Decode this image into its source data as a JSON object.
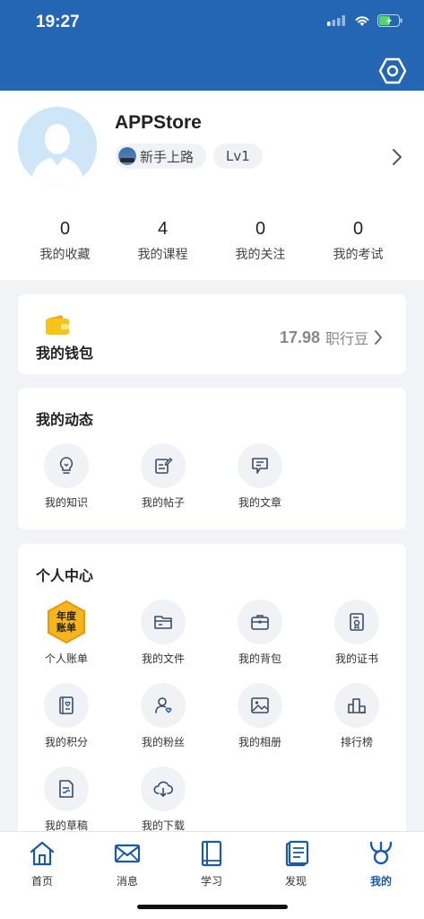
{
  "status": {
    "time": "19:27"
  },
  "profile": {
    "username": "APPStore",
    "rank_badge": "新手上路",
    "level_badge": "Lv1",
    "stats": [
      {
        "value": "0",
        "label": "我的收藏"
      },
      {
        "value": "4",
        "label": "我的课程"
      },
      {
        "value": "0",
        "label": "我的关注"
      },
      {
        "value": "0",
        "label": "我的考试"
      }
    ]
  },
  "wallet": {
    "title": "我的钱包",
    "amount": "17.98",
    "unit": "职行豆"
  },
  "dynamics": {
    "title": "我的动态",
    "items": [
      {
        "label": "我的知识",
        "icon": "lightbulb-icon"
      },
      {
        "label": "我的帖子",
        "icon": "edit-note-icon"
      },
      {
        "label": "我的文章",
        "icon": "article-icon"
      }
    ]
  },
  "personal": {
    "title": "个人中心",
    "annual_badge_text": [
      "年度",
      "账单"
    ],
    "items": [
      {
        "label": "个人账单",
        "icon": "annual-bill-icon"
      },
      {
        "label": "我的文件",
        "icon": "folder-icon"
      },
      {
        "label": "我的背包",
        "icon": "backpack-icon"
      },
      {
        "label": "我的证书",
        "icon": "certificate-icon"
      },
      {
        "label": "我的积分",
        "icon": "points-icon"
      },
      {
        "label": "我的粉丝",
        "icon": "fans-icon"
      },
      {
        "label": "我的相册",
        "icon": "album-icon"
      },
      {
        "label": "排行榜",
        "icon": "leaderboard-icon"
      },
      {
        "label": "我的草稿",
        "icon": "draft-icon"
      },
      {
        "label": "我的下载",
        "icon": "download-icon"
      }
    ]
  },
  "tabbar": {
    "active": "我的",
    "items": [
      {
        "label": "首页",
        "icon": "home-icon"
      },
      {
        "label": "消息",
        "icon": "mail-icon"
      },
      {
        "label": "学习",
        "icon": "book-icon"
      },
      {
        "label": "发现",
        "icon": "discover-icon"
      },
      {
        "label": "我的",
        "icon": "profile-icon"
      }
    ]
  },
  "colors": {
    "header": "#2466b4",
    "accent": "#1b5aa8",
    "icon": "#3b4b66",
    "wallet": "#f5c518"
  }
}
